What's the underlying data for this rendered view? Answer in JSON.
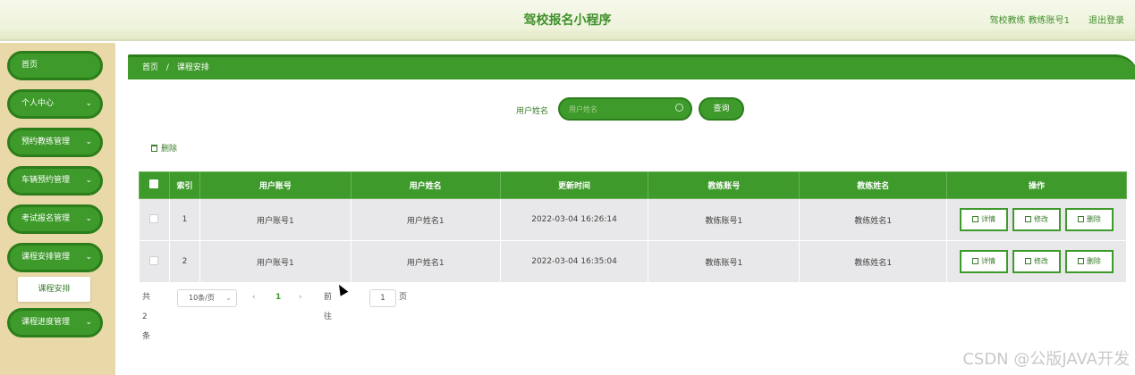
{
  "header": {
    "title": "驾校报名小程序",
    "user": "驾校教练 教练账号1",
    "logout": "退出登录"
  },
  "sidebar": {
    "items": [
      {
        "label": "首页",
        "has_chevron": false
      },
      {
        "label": "个人中心",
        "has_chevron": true
      },
      {
        "label": "预约教练管理",
        "has_chevron": true
      },
      {
        "label": "车辆预约管理",
        "has_chevron": true
      },
      {
        "label": "考试报名管理",
        "has_chevron": true
      },
      {
        "label": "课程安排管理",
        "has_chevron": true
      },
      {
        "label": "课程进度管理",
        "has_chevron": true
      }
    ],
    "sub_item": "课程安排",
    "chevron": "⌄"
  },
  "breadcrumb": {
    "home": "首页",
    "sep": "/",
    "current": "课程安排"
  },
  "search": {
    "label": "用户姓名",
    "placeholder": "用户姓名",
    "button": "查询"
  },
  "toolbar": {
    "delete": "删除"
  },
  "table": {
    "headers": [
      "索引",
      "用户账号",
      "用户姓名",
      "更新时间",
      "教练账号",
      "教练姓名",
      "操作"
    ],
    "rows": [
      {
        "index": "1",
        "user_account": "用户账号1",
        "user_name": "用户姓名1",
        "updated": "2022-03-04 16:26:14",
        "coach_account": "教练账号1",
        "coach_name": "教练姓名1"
      },
      {
        "index": "2",
        "user_account": "用户账号1",
        "user_name": "用户姓名1",
        "updated": "2022-03-04 16:35:04",
        "coach_account": "教练账号1",
        "coach_name": "教练姓名1"
      }
    ],
    "actions": {
      "detail": "详情",
      "edit": "修改",
      "delete": "删除"
    }
  },
  "pagination": {
    "total": "共 2 条",
    "page_size": "10条/页",
    "prev": "‹",
    "current_page": "1",
    "next": "›",
    "goto_label": "前往",
    "goto_value": "1",
    "page_unit": "页"
  },
  "watermark": "CSDN @公版JAVA开发",
  "colors": {
    "primary": "#3e9a2b",
    "primary_dark": "#2c7e1b",
    "sidebar_bg": "#ead9a8",
    "header_bg": "#eef3dc"
  }
}
